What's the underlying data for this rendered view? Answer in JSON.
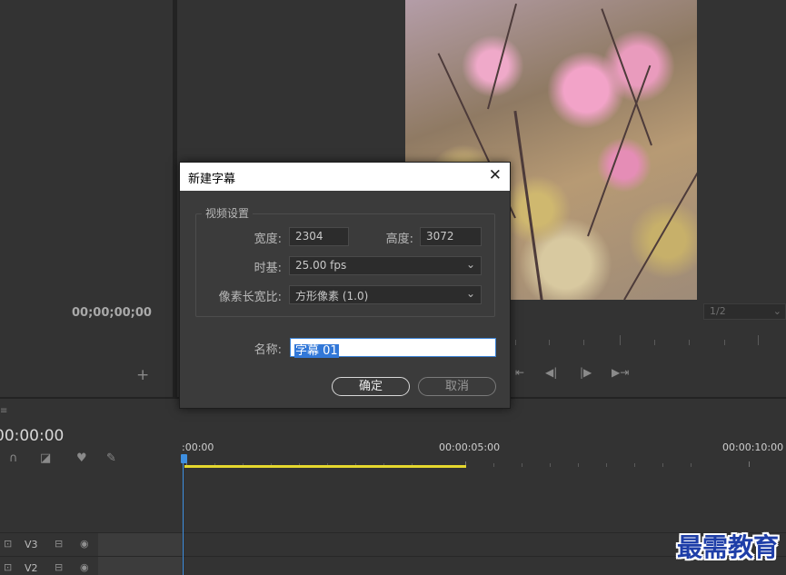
{
  "source_panel": {
    "timecode": "00;00;00;00",
    "add_icon": "plus-icon"
  },
  "monitor": {
    "zoom": "1/2",
    "transport_icons": [
      "step-back-icon",
      "play-reverse-icon",
      "play-icon",
      "step-forward-icon"
    ]
  },
  "timeline": {
    "menu_glyph": "≡",
    "current_time": "00:00:00",
    "ruler_labels": [
      ":00:00",
      "00:00:05:00",
      "00:00:10:00"
    ],
    "tracks": [
      {
        "name": "V3"
      },
      {
        "name": "V2"
      }
    ]
  },
  "dialog": {
    "title": "新建字幕",
    "group_title": "视频设置",
    "width_label": "宽度:",
    "width_value": "2304",
    "height_label": "高度:",
    "height_value": "3072",
    "timebase_label": "时基:",
    "timebase_value": "25.00 fps",
    "par_label": "像素长宽比:",
    "par_value": "方形像素 (1.0)",
    "name_label": "名称:",
    "name_value": "字幕 01",
    "ok_label": "确定",
    "cancel_label": "取消"
  },
  "watermark": "最需教育",
  "colors": {
    "accent_blue": "#3278d8",
    "work_area": "#e5d82e",
    "playhead": "#3e8fe0"
  }
}
